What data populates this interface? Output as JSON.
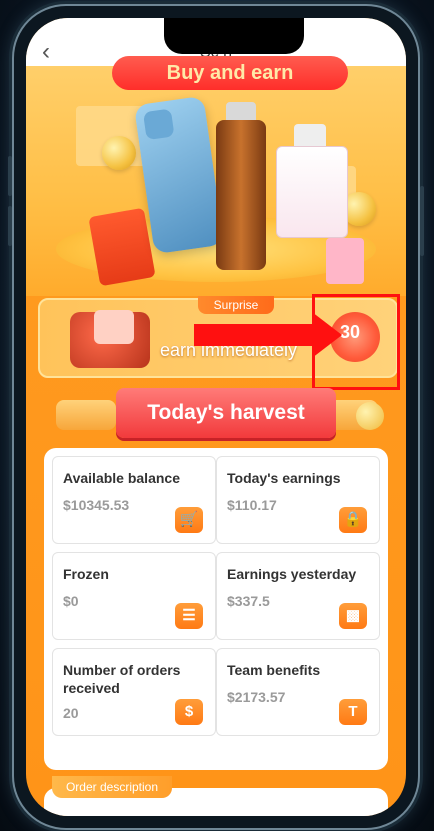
{
  "header": {
    "back_icon": "chevron-left-icon",
    "title": "Sc                  n"
  },
  "banner": {
    "title": "Buy and earn"
  },
  "surprise": {
    "tag": "Surprise",
    "text": "earn immediately",
    "badge_number": "30"
  },
  "harvest": {
    "label": "Today's harvest"
  },
  "stats": [
    {
      "label": "Available balance",
      "value": "$10345.53",
      "icon": "shopping-cart-icon"
    },
    {
      "label": "Today's earnings",
      "value": "$110.17",
      "icon": "lock-icon"
    },
    {
      "label": "Frozen",
      "value": "$0",
      "icon": "document-icon"
    },
    {
      "label": "Earnings yesterday",
      "value": "$337.5",
      "icon": "wallet-icon"
    },
    {
      "label": "Number of orders received",
      "value": "20",
      "icon": "money-bag-icon"
    },
    {
      "label": "Team benefits",
      "value": "$2173.57",
      "icon": "bag-icon"
    }
  ],
  "order": {
    "tag": "Order description"
  },
  "colors": {
    "accent": "#ff9418",
    "harvest": "#f23a3c",
    "annotation": "#ff1010"
  }
}
